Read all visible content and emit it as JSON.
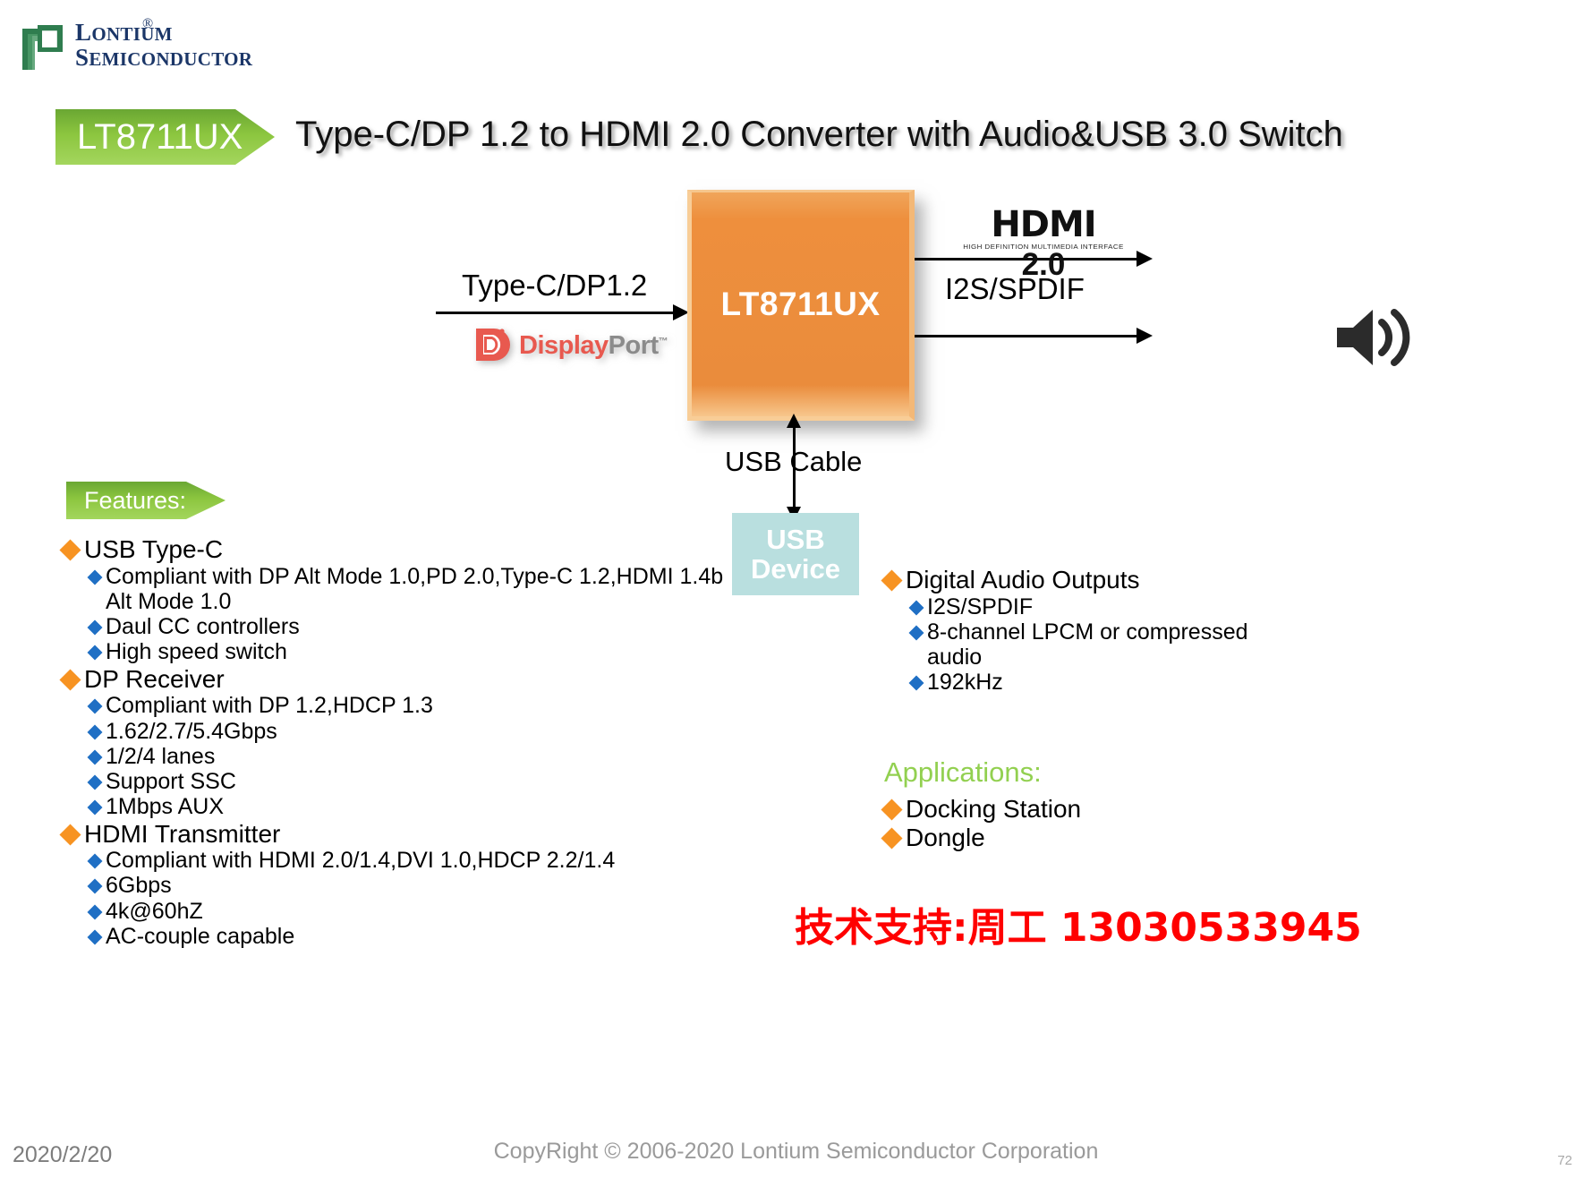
{
  "logo": {
    "icon": "lontium-bracket-logo",
    "line1": "LONTIUM",
    "line2": "SEMICONDUCTOR",
    "registered": "®"
  },
  "header": {
    "part_badge": "LT8711UX",
    "title": "Type-C/DP 1.2 to HDMI 2.0 Converter with Audio&USB 3.0 Switch"
  },
  "diagram": {
    "chip_label": "LT8711UX",
    "input_label": "Type-C/DP1.2",
    "displayport_logo": {
      "icon": "displayport-icon",
      "text_red": "Display",
      "text_gray": "Port",
      "trademark": "™"
    },
    "hdmi_logo": {
      "word": "HDMI",
      "subtitle": "HIGH DEFINITION MULTIMEDIA INTERFACE",
      "version": "2.0"
    },
    "audio_out_label": "I2S/SPDIF",
    "speaker_icon": "speaker-icon",
    "usb_cable_label": "USB Cable",
    "usb_device_line1": "USB",
    "usb_device_line2": "Device"
  },
  "features": {
    "heading": "Features:",
    "groups": [
      {
        "title": "USB Type-C",
        "items": [
          "Compliant with DP Alt Mode 1.0,PD 2.0,Type-C 1.2,HDMI 1.4b Alt Mode 1.0",
          "Daul CC controllers",
          "High speed switch"
        ]
      },
      {
        "title": "DP Receiver",
        "items": [
          "Compliant with DP 1.2,HDCP 1.3",
          "1.62/2.7/5.4Gbps",
          "1/2/4 lanes",
          "Support SSC",
          "1Mbps AUX"
        ]
      },
      {
        "title": "HDMI Transmitter",
        "items": [
          "Compliant with HDMI 2.0/1.4,DVI 1.0,HDCP 2.2/1.4",
          "6Gbps",
          "4k@60hZ",
          "AC-couple capable"
        ]
      }
    ],
    "right_groups": [
      {
        "title": "Digital Audio Outputs",
        "items": [
          "I2S/SPDIF",
          "8-channel LPCM or compressed audio",
          "192kHz"
        ]
      }
    ]
  },
  "applications": {
    "heading": "Applications:",
    "items": [
      "Docking Station",
      "Dongle"
    ]
  },
  "contact": {
    "text": "技术支持:周工 13030533945"
  },
  "footer": {
    "date": "2020/2/20",
    "copyright": "CopyRight © 2006-2020 Lontium Semiconductor Corporation",
    "page_number": "72"
  },
  "colors": {
    "chip_orange": "#ea8c3c",
    "banner_green": "#8cc63f",
    "usb_box_blue": "#b9dfdf",
    "bullet_orange": "#f79322",
    "bullet_blue": "#1f6fc4",
    "applications_green": "#92d050",
    "contact_red": "#ff0000",
    "logo_navy": "#1b3668"
  }
}
